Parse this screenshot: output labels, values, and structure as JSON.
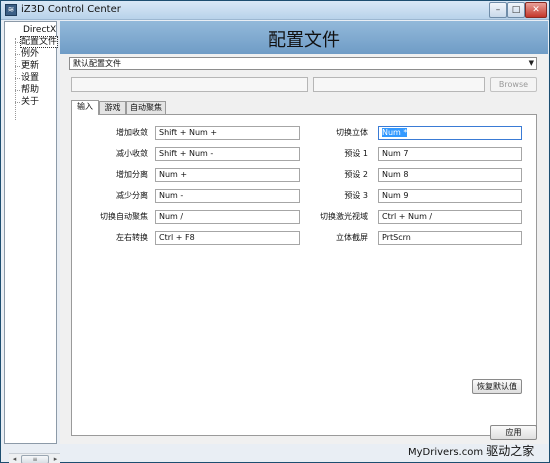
{
  "window": {
    "title": "iZ3D Control Center",
    "icon": "iz3d-app-icon",
    "controls": {
      "minimize": "–",
      "maximize": "□",
      "close": "✕"
    }
  },
  "sidebar": {
    "items": [
      {
        "label": "DirectX",
        "level": 0
      },
      {
        "label": "配置文件",
        "level": 1,
        "selected": true
      },
      {
        "label": "例外",
        "level": 1
      },
      {
        "label": "更新",
        "level": 1
      },
      {
        "label": "设置",
        "level": 1
      },
      {
        "label": "帮助",
        "level": 1
      },
      {
        "label": "关于",
        "level": 1
      }
    ],
    "scroll": {
      "left": "◂",
      "right": "▸",
      "thumb": "≡"
    }
  },
  "header": {
    "title": "配置文件"
  },
  "profile": {
    "selected": "默认配置文件"
  },
  "browse": {
    "label": "Browse"
  },
  "tabs": [
    {
      "label": "输入",
      "active": true
    },
    {
      "label": "游戏",
      "active": false
    },
    {
      "label": "自动聚焦",
      "active": false
    }
  ],
  "left_bindings": [
    {
      "label": "增加收敛",
      "key": "Shift + Num +"
    },
    {
      "label": "减小收敛",
      "key": "Shift + Num -"
    },
    {
      "label": "增加分离",
      "key": "Num +"
    },
    {
      "label": "减少分离",
      "key": "Num -"
    },
    {
      "label": "切换自动聚焦",
      "key": "Num /"
    },
    {
      "label": "左右转换",
      "key": "Ctrl + F8"
    }
  ],
  "right_bindings": [
    {
      "label": "切换立体",
      "key": "Num *",
      "focused": true
    },
    {
      "label": "预设 1",
      "key": "Num 7"
    },
    {
      "label": "预设 2",
      "key": "Num 8"
    },
    {
      "label": "预设 3",
      "key": "Num 9"
    },
    {
      "label": "切换激光视域",
      "key": "Ctrl + Num /"
    },
    {
      "label": "立体截屏",
      "key": "PrtScrn"
    }
  ],
  "restore_defaults": {
    "label": "恢复默认值"
  },
  "apply": {
    "label": "应用"
  },
  "watermark": {
    "prefix": "MyDrivers.com",
    "cn": "驱动之家"
  },
  "colors": {
    "header_gradient_top": "#93b9da",
    "header_gradient_bottom": "#6f9cc6",
    "selection": "#3399ff"
  }
}
